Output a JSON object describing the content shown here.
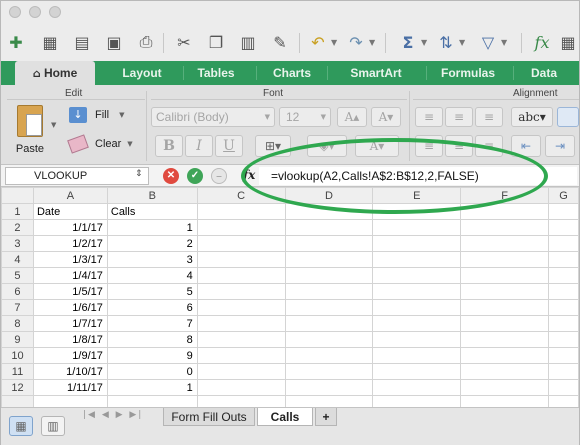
{
  "tabs": [
    "Home",
    "Layout",
    "Tables",
    "Charts",
    "SmartArt",
    "Formulas",
    "Data"
  ],
  "ribbon": {
    "edit_label": "Edit",
    "paste_label": "Paste",
    "fill_label": "Fill",
    "clear_label": "Clear",
    "font_label": "Font",
    "font_name": "Calibri (Body)",
    "font_size": "12",
    "bold": "B",
    "italic": "I",
    "underline": "U",
    "alignment_label": "Alignment",
    "abc_label": "abc"
  },
  "formula_bar": {
    "name_box": "VLOOKUP",
    "fx": "fx",
    "formula": "=vlookup(A2,Calls!A$2:B$12,2,FALSE)"
  },
  "grid": {
    "columns": [
      "A",
      "B",
      "C",
      "D",
      "E",
      "F",
      "G"
    ],
    "rows": [
      {
        "n": "1",
        "a": "Date",
        "b": "Calls"
      },
      {
        "n": "2",
        "a": "1/1/17",
        "b": "1"
      },
      {
        "n": "3",
        "a": "1/2/17",
        "b": "2"
      },
      {
        "n": "4",
        "a": "1/3/17",
        "b": "3"
      },
      {
        "n": "5",
        "a": "1/4/17",
        "b": "4"
      },
      {
        "n": "6",
        "a": "1/5/17",
        "b": "5"
      },
      {
        "n": "7",
        "a": "1/6/17",
        "b": "6"
      },
      {
        "n": "8",
        "a": "1/7/17",
        "b": "7"
      },
      {
        "n": "9",
        "a": "1/8/17",
        "b": "8"
      },
      {
        "n": "10",
        "a": "1/9/17",
        "b": "9"
      },
      {
        "n": "11",
        "a": "1/10/17",
        "b": "0"
      },
      {
        "n": "12",
        "a": "1/11/17",
        "b": "1"
      }
    ]
  },
  "sheets": [
    "Form Fill Outs",
    "Calls",
    "+"
  ],
  "colors": {
    "accent": "#2f9a5c",
    "highlight": "#2fa84f"
  }
}
